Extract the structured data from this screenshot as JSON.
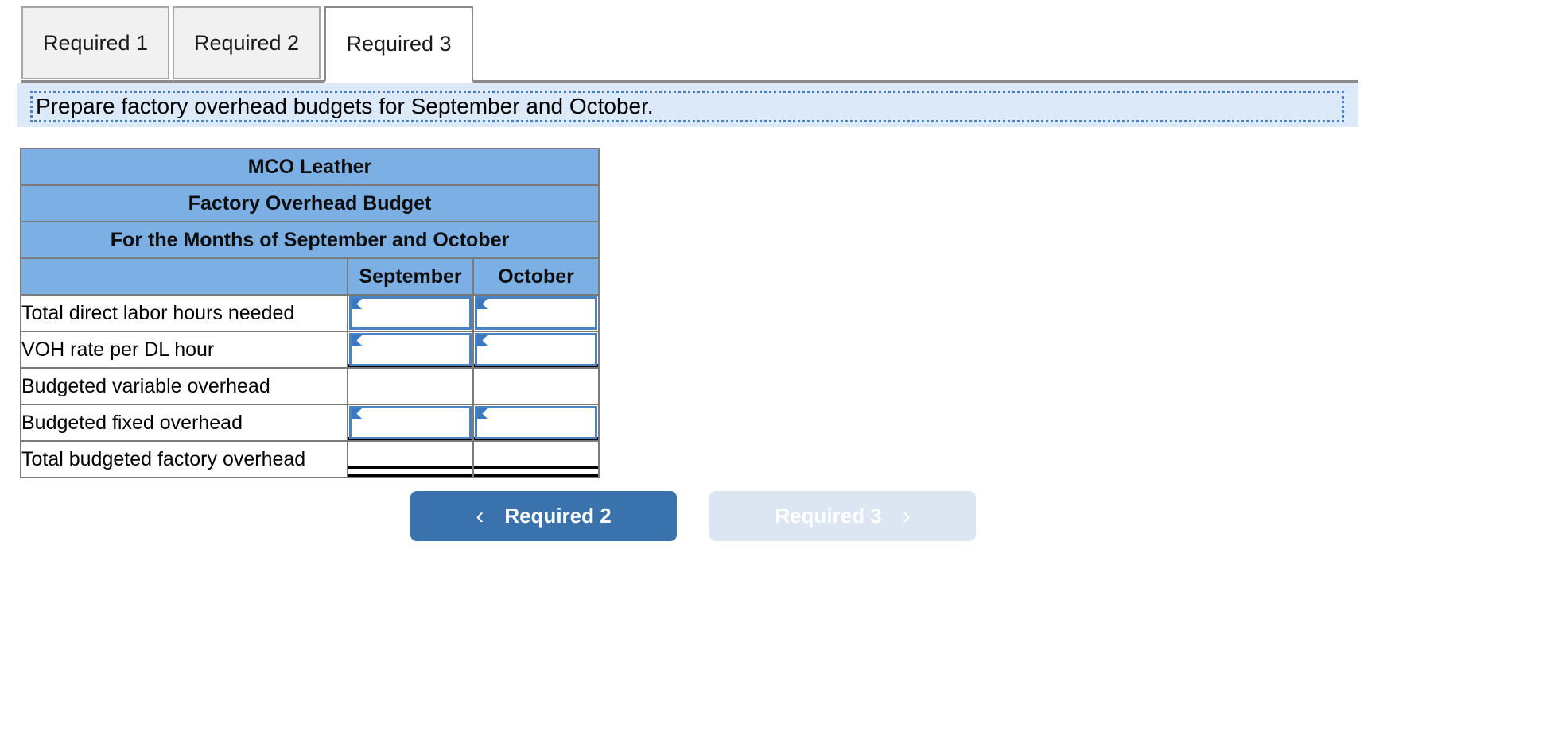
{
  "tabs": [
    {
      "label": "Required 1",
      "active": false
    },
    {
      "label": "Required 2",
      "active": false
    },
    {
      "label": "Required 3",
      "active": true
    }
  ],
  "instruction": {
    "text": "Prepare factory overhead budgets for September and October."
  },
  "table": {
    "title_lines": [
      "MCO Leather",
      "Factory Overhead Budget",
      "For the Months of September and October"
    ],
    "column_headers": [
      "",
      "September",
      "October"
    ],
    "rows": [
      {
        "label": "Total direct labor hours needed",
        "september": "",
        "october": "",
        "input": true,
        "rule": "none"
      },
      {
        "label": "VOH rate per DL hour",
        "september": "",
        "october": "",
        "input": true,
        "rule": "single"
      },
      {
        "label": "Budgeted variable overhead",
        "september": "",
        "october": "",
        "input": false,
        "rule": "none"
      },
      {
        "label": "Budgeted fixed overhead",
        "september": "",
        "october": "",
        "input": true,
        "rule": "single"
      },
      {
        "label": "Total budgeted factory overhead",
        "september": "",
        "october": "",
        "input": false,
        "rule": "double"
      }
    ]
  },
  "navigation": {
    "prev_label": "Required 2",
    "next_label": "Required 3",
    "prev_icon": "chevron-left-icon",
    "next_icon": "chevron-right-icon",
    "prev_chevron": "‹",
    "next_chevron": "›"
  },
  "colors": {
    "header_blue": "#7cb0e4",
    "instruction_bg": "#dbe9f8",
    "instruction_border": "#4a7fc1",
    "input_border": "#4a82c4",
    "flag_blue": "#3b78c2",
    "btn_primary": "#3a72ae",
    "btn_disabled": "#dce6f2",
    "tab_inactive": "#f1f1f1",
    "tab_border": "#a6a6a6"
  }
}
